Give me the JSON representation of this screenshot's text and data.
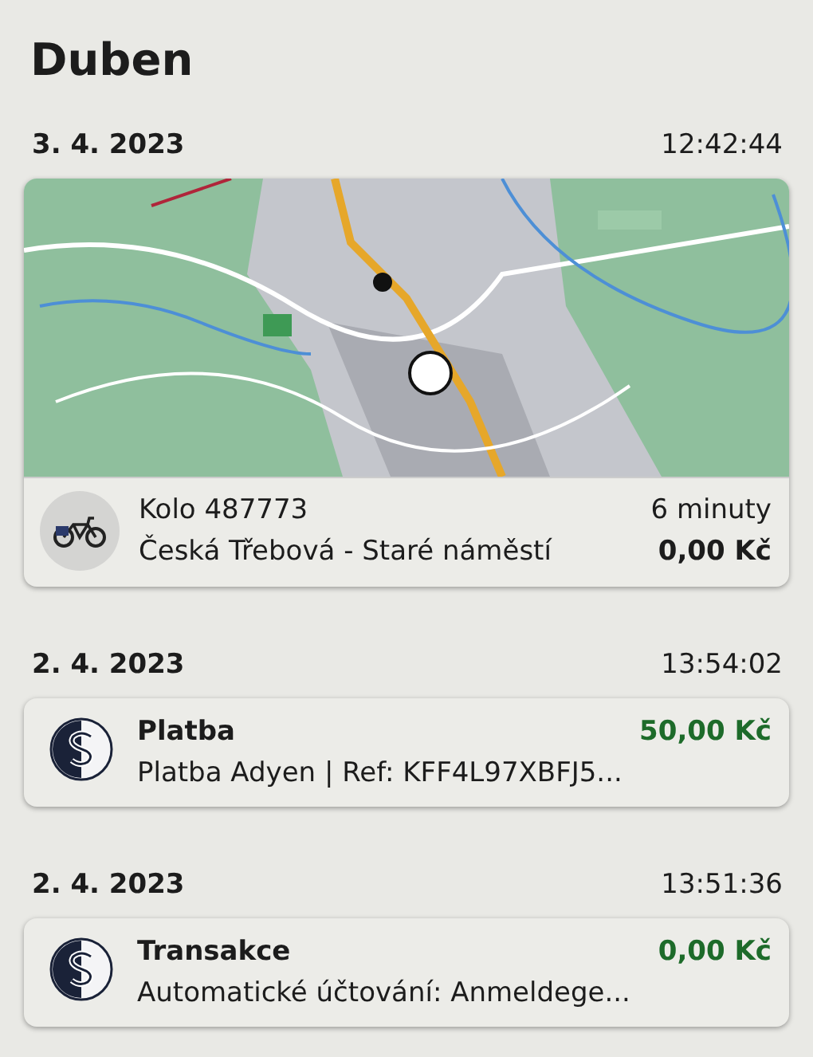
{
  "title": "Duben",
  "entries": [
    {
      "kind": "ride",
      "date": "3. 4. 2023",
      "time": "12:42:44",
      "name": "Kolo 487773",
      "detail": "Česká Třebová - Staré náměstí",
      "duration": "6 minuty",
      "amount": "0,00 Kč"
    },
    {
      "kind": "payment",
      "date": "2. 4. 2023",
      "time": "13:54:02",
      "name": "Platba",
      "detail": "Platba Adyen | Ref: KFF4L97XBFJ5...",
      "amount": "50,00 Kč"
    },
    {
      "kind": "payment",
      "date": "2. 4. 2023",
      "time": "13:51:36",
      "name": "Transakce",
      "detail": "Automatické účtování: Anmeldege...",
      "amount": "0,00 Kč"
    }
  ]
}
